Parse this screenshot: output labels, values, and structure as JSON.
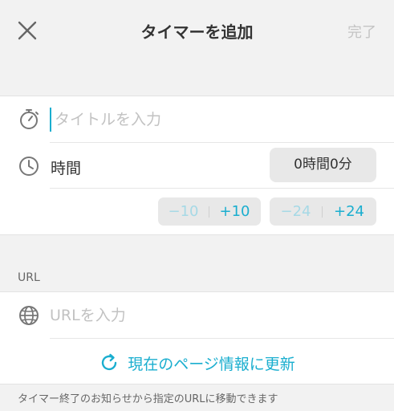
{
  "header": {
    "title": "タイマーを追加",
    "done_label": "完了",
    "close_icon": "close-icon"
  },
  "timer": {
    "title_placeholder": "タイトルを入力",
    "time_label": "時間",
    "time_value": "0時間0分",
    "adjust": {
      "minutes_minus": "−10",
      "minutes_plus": "+10",
      "hours_minus": "−24",
      "hours_plus": "+24"
    }
  },
  "url_section": {
    "label": "URL",
    "placeholder": "URLを入力",
    "refresh_label": "現在のページ情報に更新"
  },
  "footer": {
    "note": "タイマー終了のお知らせから指定のURLに移動できます"
  },
  "colors": {
    "accent": "#1aaecf",
    "accent_disabled": "#a6d9e6",
    "background": "#f2f2f2"
  }
}
